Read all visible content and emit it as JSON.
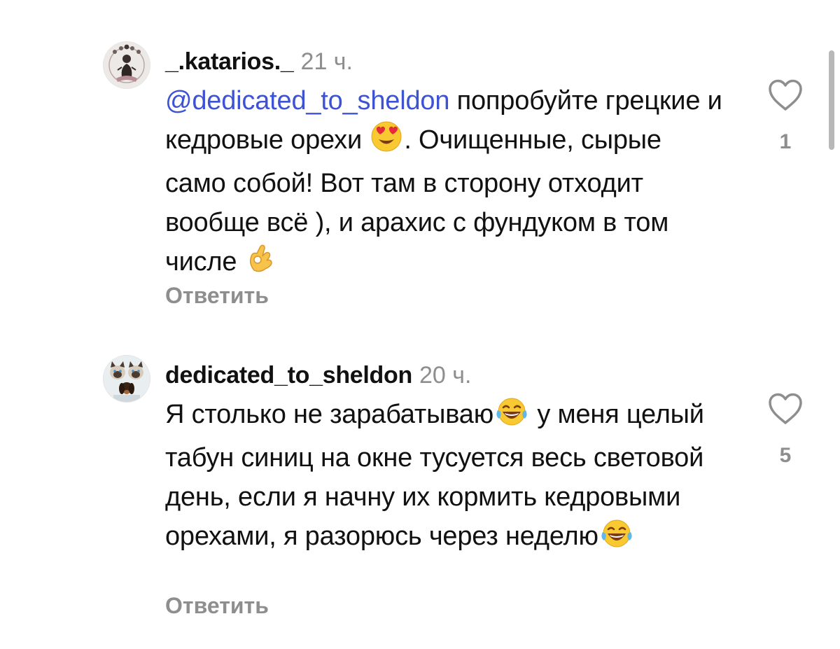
{
  "comments": [
    {
      "username": "_.katarios._",
      "time": "21 ч.",
      "mention": "@dedicated_to_sheldon",
      "text_1": " попробуйте грецкие и кедровые орехи ",
      "emoji_1": "heart-eyes-emoji",
      "text_2": ". Очищенные, сырые само собой! Вот там в сторону отходит вообще всё ), и арахис с фундуком в том числе ",
      "emoji_2": "ok-hand-emoji",
      "like_count": "1",
      "reply_label": "Ответить"
    },
    {
      "username": "dedicated_to_sheldon",
      "time": "20 ч.",
      "text_1": "Я столько не зарабатываю",
      "emoji_1": "laughing-tears-emoji",
      "text_2": " у меня целый табун синиц на окне тусуется весь световой день, если я начну их кормить кедровыми орехами, я разорюсь через неделю",
      "emoji_2": "laughing-tears-emoji",
      "like_count": "5",
      "reply_label": "Ответить"
    }
  ],
  "colors": {
    "mention": "#3d53d4",
    "secondary_text": "#8e8e8e",
    "primary_text": "#111111"
  }
}
